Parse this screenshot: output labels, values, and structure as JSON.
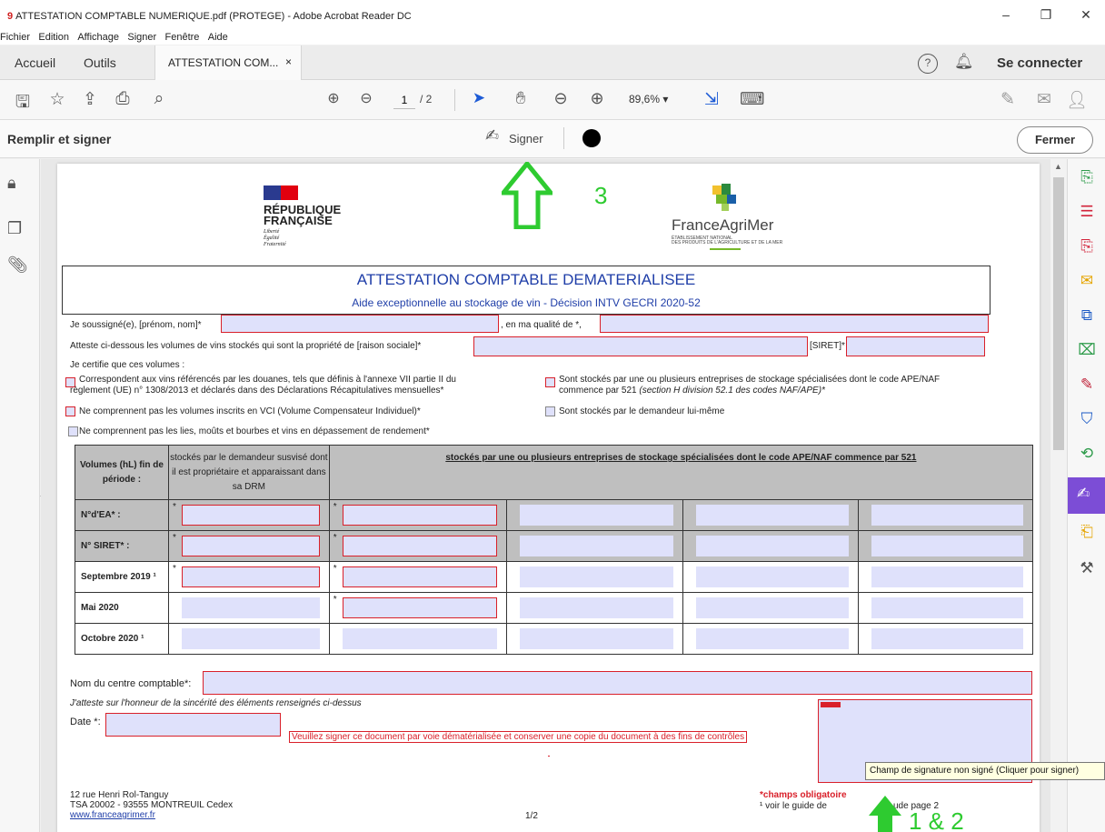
{
  "window": {
    "title": "ATTESTATION COMPTABLE NUMERIQUE.pdf (PROTEGE) - Adobe Acrobat Reader DC",
    "app_icon": "9",
    "controls": [
      "–",
      "❐",
      "✕"
    ]
  },
  "menu": [
    "Fichier",
    "Edition",
    "Affichage",
    "Signer",
    "Fenêtre",
    "Aide"
  ],
  "tabs": {
    "home": "Accueil",
    "tools": "Outils",
    "document": "ATTESTATION COM...",
    "close": "×",
    "help_icon": "?",
    "signin": "Se connecter"
  },
  "toolbar": {
    "page_current": "1",
    "page_total": "/ 2",
    "zoom": "89,6%  ▾"
  },
  "signbar": {
    "title": "Remplir et signer",
    "sign_label": "Signer",
    "close_label": "Fermer"
  },
  "document": {
    "rf_title1": "RÉPUBLIQUE",
    "rf_title2": "FRANÇAISE",
    "rf_motto1": "Liberté",
    "rf_motto2": "Égalité",
    "rf_motto3": "Fraternité",
    "fam_name": "FranceAgriMer",
    "fam_sub1": "ÉTABLISSEMENT NATIONAL",
    "fam_sub2": "DES PRODUITS DE L'AGRICULTURE ET DE LA MER",
    "heading": "ATTESTATION COMPTABLE DEMATERIALISEE",
    "subheading": "Aide exceptionnelle au stockage de vin - Décision INTV GECRI 2020-52",
    "line1_label": "Je soussigné(e), [prénom, nom]*",
    "line1_quality": ", en ma qualité de *,",
    "line2_label": "Atteste ci-dessous les volumes de vins stockés qui sont la propriété de [raison sociale]*",
    "line2_siret": "[SIRET]*",
    "certify": "Je certifie que ces volumes :",
    "check1_a": "Correspondent aux vins référencés par les douanes, tels que définis à l'annexe VII partie II du",
    "check1_b": "règlement (UE) n° 1308/2013 et déclarés dans des Déclarations Récapitulatives mensuelles*",
    "check2_a": "Sont stockés par une ou plusieurs entreprises de stockage spécialisées dont le code APE/NAF",
    "check2_b": "commence par 521 ",
    "check2_b_italic": "(section H division 52.1 des codes NAF/APE)*",
    "check3": "Ne comprennent pas les volumes inscrits en VCI (Volume Compensateur Individuel)*",
    "check4": "Sont stockés par le demandeur lui-même",
    "check5": "Ne comprennent pas les lies, moûts et bourbes et vins en dépassement de rendement*",
    "table": {
      "h_volumes": "Volumes (hL) fin de période :",
      "h_demandeur": "stockés par le demandeur susvisé dont il est propriétaire et apparaissant dans sa DRM",
      "h_entreprises": "stockés par une ou plusieurs entreprises de stockage spécialisées dont le code APE/NAF commence par 521",
      "rows": [
        "N°d'EA* :",
        "N° SIRET* :",
        "Septembre 2019 ¹",
        "Mai 2020",
        "Octobre 2020 ¹"
      ],
      "star": "*"
    },
    "centre_label": "Nom du centre comptable*:",
    "honour": "J'atteste sur l'honneur de la sincérité des éléments renseignés ci-dessus",
    "date_label": "Date *:",
    "sign_notice": "Veuillez signer ce document par voie dématérialisée et conserver une copie du document à des fins de contrôles",
    "addr1": "12 rue Henri Rol-Tanguy",
    "addr2": "TSA 20002 - 93555 MONTREUIL Cedex",
    "website": "www.franceagrimer.fr",
    "page_no": "1/2",
    "mandatory": "*champs obligatoire",
    "guide": "¹ voir le guide de",
    "guide2": "ude page 2"
  },
  "tooltip": "Champ de signature non signé (Cliquer pour signer)",
  "annotations": {
    "three": "3",
    "one_two": "1 & 2"
  },
  "colors": {
    "required_border": "#d9202a",
    "field_fill": "#dfe1fb",
    "heading_blue": "#1f3ea8",
    "annotation_green": "#2ecb30",
    "active_tool": "#7c4dd6"
  }
}
